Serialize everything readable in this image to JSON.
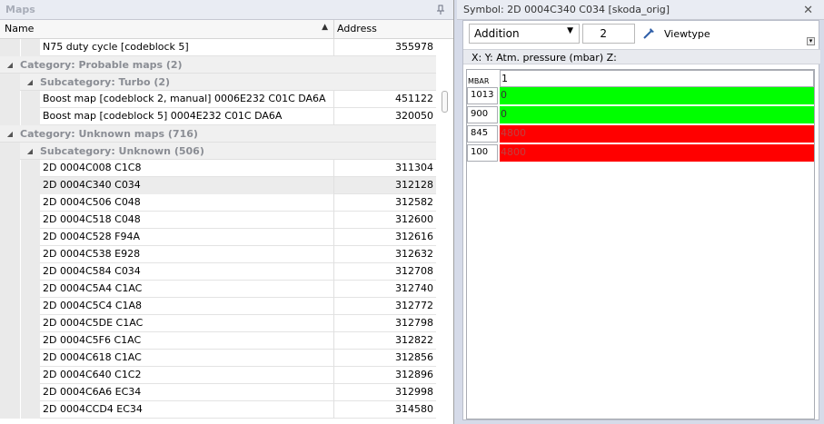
{
  "maps_panel": {
    "title": "Maps",
    "pin_icon": "pin-icon",
    "columns": {
      "name": "Name",
      "address": "Address"
    },
    "rows": [
      {
        "type": "item",
        "level": 2,
        "name": "N75 duty cycle [codeblock 5]",
        "address": "355978"
      },
      {
        "type": "category",
        "label": "Category: Probable maps (2)"
      },
      {
        "type": "subcategory",
        "label": "Subcategory: Turbo (2)"
      },
      {
        "type": "item",
        "level": 2,
        "name": "Boost map [codeblock 2, manual] 0006E232 C01C DA6A",
        "address": "451122"
      },
      {
        "type": "item",
        "level": 2,
        "name": "Boost map [codeblock 5] 0004E232 C01C DA6A",
        "address": "320050"
      },
      {
        "type": "category",
        "label": "Category: Unknown maps (716)"
      },
      {
        "type": "subcategory",
        "label": "Subcategory: Unknown (506)"
      },
      {
        "type": "item",
        "level": 2,
        "name": "2D 0004C008 C1C8",
        "address": "311304"
      },
      {
        "type": "item",
        "level": 2,
        "name": "2D 0004C340 C034",
        "address": "312128",
        "selected": true
      },
      {
        "type": "item",
        "level": 2,
        "name": "2D 0004C506 C048",
        "address": "312582"
      },
      {
        "type": "item",
        "level": 2,
        "name": "2D 0004C518 C048",
        "address": "312600"
      },
      {
        "type": "item",
        "level": 2,
        "name": "2D 0004C528 F94A",
        "address": "312616"
      },
      {
        "type": "item",
        "level": 2,
        "name": "2D 0004C538 E928",
        "address": "312632"
      },
      {
        "type": "item",
        "level": 2,
        "name": "2D 0004C584 C034",
        "address": "312708"
      },
      {
        "type": "item",
        "level": 2,
        "name": "2D 0004C5A4 C1AC",
        "address": "312740"
      },
      {
        "type": "item",
        "level": 2,
        "name": "2D 0004C5C4 C1A8",
        "address": "312772"
      },
      {
        "type": "item",
        "level": 2,
        "name": "2D 0004C5DE C1AC",
        "address": "312798"
      },
      {
        "type": "item",
        "level": 2,
        "name": "2D 0004C5F6 C1AC",
        "address": "312822"
      },
      {
        "type": "item",
        "level": 2,
        "name": "2D 0004C618 C1AC",
        "address": "312856"
      },
      {
        "type": "item",
        "level": 2,
        "name": "2D 0004C640 C1C2",
        "address": "312896"
      },
      {
        "type": "item",
        "level": 2,
        "name": "2D 0004C6A6 EC34",
        "address": "312998"
      },
      {
        "type": "item",
        "level": 2,
        "name": "2D 0004CCD4 EC34",
        "address": "314580"
      }
    ]
  },
  "symbol_panel": {
    "title": "Symbol: 2D 0004C340 C034 [skoda_orig]",
    "mode": "Addition",
    "value": "2",
    "viewtype_label": "Viewtype",
    "axis_caption": "X:  Y: Atm. pressure (mbar) Z:",
    "grid": {
      "unit_label": "MBAR",
      "column_header": "1",
      "rows": [
        {
          "y": "1013",
          "value": "0",
          "color": "#00ff00"
        },
        {
          "y": "900",
          "value": "0",
          "color": "#00ff00"
        },
        {
          "y": "845",
          "value": "4800",
          "color": "#ff0000"
        },
        {
          "y": "100",
          "value": "4800",
          "color": "#ff0000"
        }
      ]
    }
  }
}
